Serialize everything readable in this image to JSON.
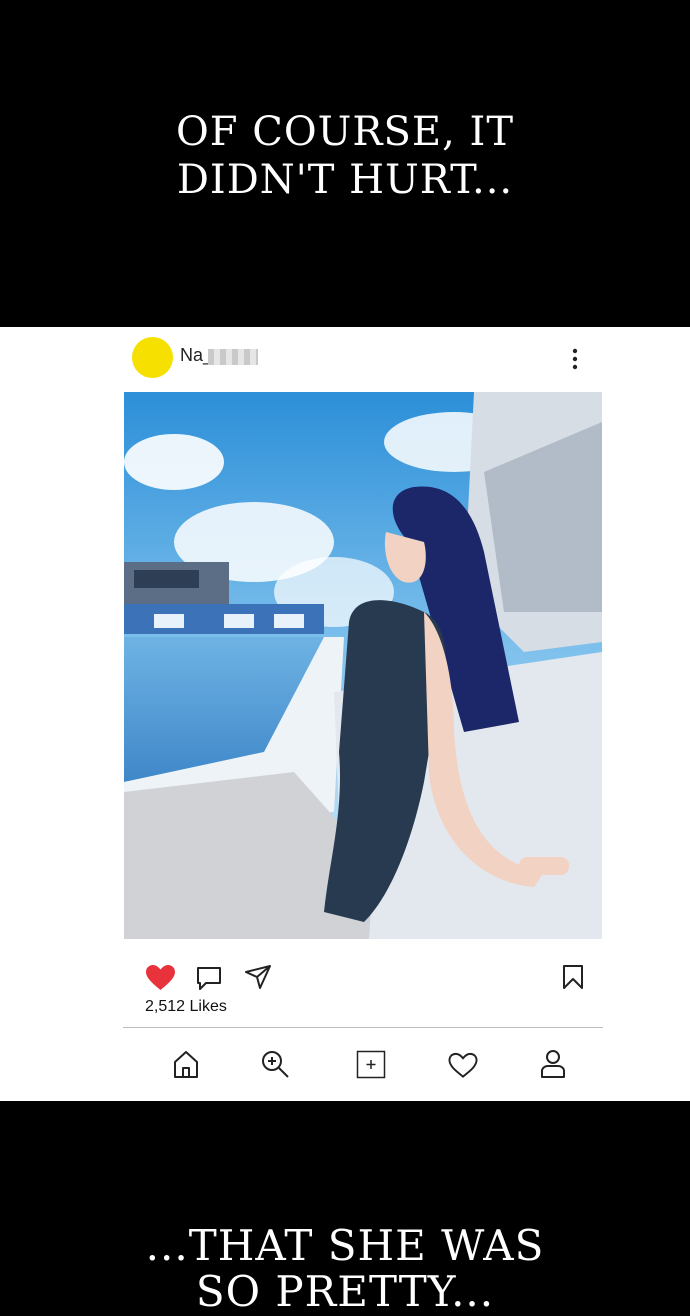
{
  "captions": {
    "top_line1": "OF COURSE, IT",
    "top_line2": "DIDN'T HURT...",
    "bottom_line1": "...THAT SHE WAS",
    "bottom_line2": "SO PRETTY..."
  },
  "post": {
    "username": "Na_",
    "likes": "2,512 Likes",
    "avatar_color": "#f6e000",
    "liked": true
  },
  "icons": {
    "header": [
      "more-vertical-icon"
    ],
    "actions": [
      "heart-filled-icon",
      "comment-icon",
      "share-icon",
      "bookmark-icon"
    ],
    "nav": [
      "home-icon",
      "search-icon",
      "add-post-icon",
      "heart-icon",
      "profile-icon"
    ]
  },
  "colors": {
    "heart": "#e8323c",
    "background": "#000000",
    "card": "#ffffff"
  }
}
